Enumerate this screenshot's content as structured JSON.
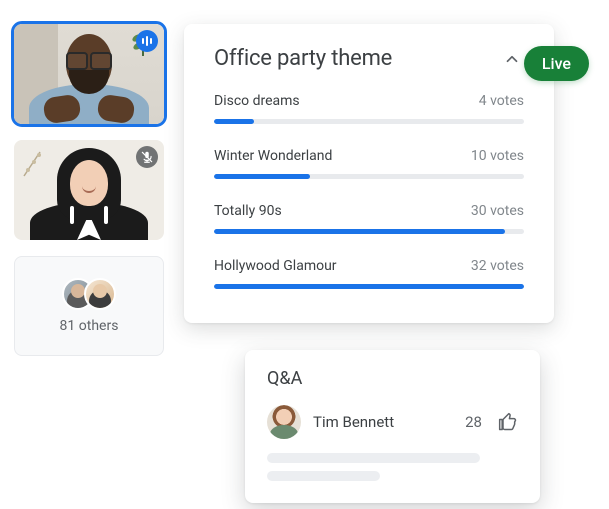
{
  "live_badge": "Live",
  "participants": {
    "others_label": "81 others"
  },
  "poll": {
    "title": "Office party theme",
    "max_votes": 32,
    "options": [
      {
        "label": "Disco dreams",
        "votes_text": "4 votes",
        "votes": 4
      },
      {
        "label": "Winter Wonderland",
        "votes_text": "10 votes",
        "votes": 10
      },
      {
        "label": "Totally 90s",
        "votes_text": "30 votes",
        "votes": 30
      },
      {
        "label": "Hollywood Glamour",
        "votes_text": "32 votes",
        "votes": 32
      }
    ]
  },
  "qa": {
    "title": "Q&A",
    "entry": {
      "name": "Tim Bennett",
      "upvotes": "28"
    }
  },
  "icons": {
    "chevron_up": "chevron-up-icon",
    "speaking": "speaking-icon",
    "muted": "mic-off-icon",
    "thumbs_up": "thumbs-up-icon"
  }
}
